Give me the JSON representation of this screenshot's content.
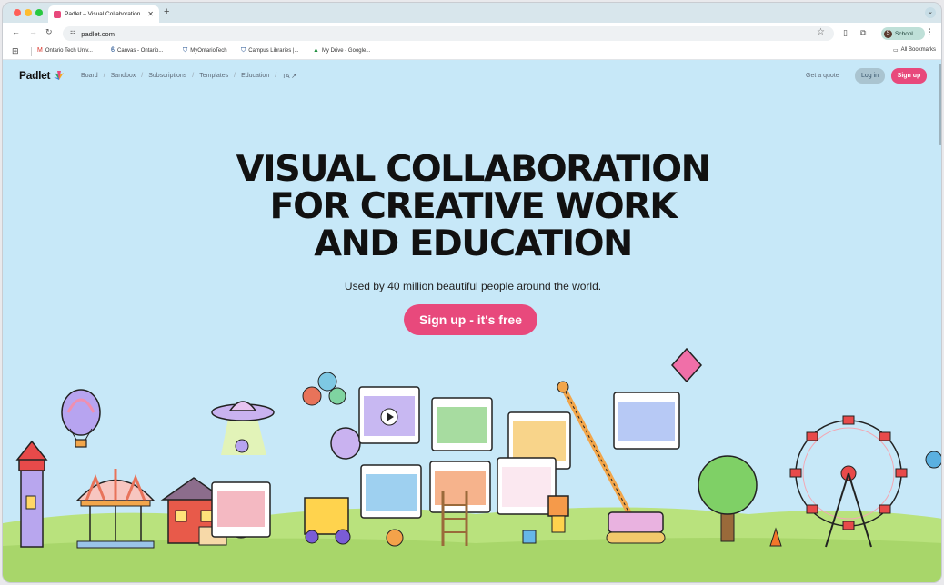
{
  "browser": {
    "tab_title": "Padlet – Visual Collaboration",
    "tab_close": "✕",
    "new_tab": "+",
    "url": "padlet.com",
    "profile_initial": "S",
    "profile_label": "School",
    "bookmarks": [
      {
        "label": "Ontario Tech Univ...",
        "icon": "gmail-icon"
      },
      {
        "label": "Canvas - Ontario...",
        "icon": "ontario-tech-icon"
      },
      {
        "label": "MyOntarioTech",
        "icon": "shield-icon"
      },
      {
        "label": "Campus Libraries |...",
        "icon": "shield-icon"
      },
      {
        "label": "My Drive - Google...",
        "icon": "drive-icon"
      }
    ],
    "all_bookmarks": "All Bookmarks"
  },
  "nav": {
    "logo": "Padlet",
    "links": [
      "Board",
      "Sandbox",
      "Subscriptions",
      "Templates",
      "Education",
      "TA"
    ],
    "separator": "/",
    "get_quote": "Get a quote",
    "login": "Log in",
    "signup": "Sign up"
  },
  "hero": {
    "headline_lines": [
      "VISUAL COLLABORATION",
      "FOR CREATIVE WORK",
      "AND EDUCATION"
    ],
    "subhead": "Used by 40 million beautiful people around the world.",
    "cta": "Sign up - it's free"
  },
  "colors": {
    "page_bg": "#c7e8f8",
    "brand_pink": "#e8497c",
    "grass": "#b9e27d"
  }
}
